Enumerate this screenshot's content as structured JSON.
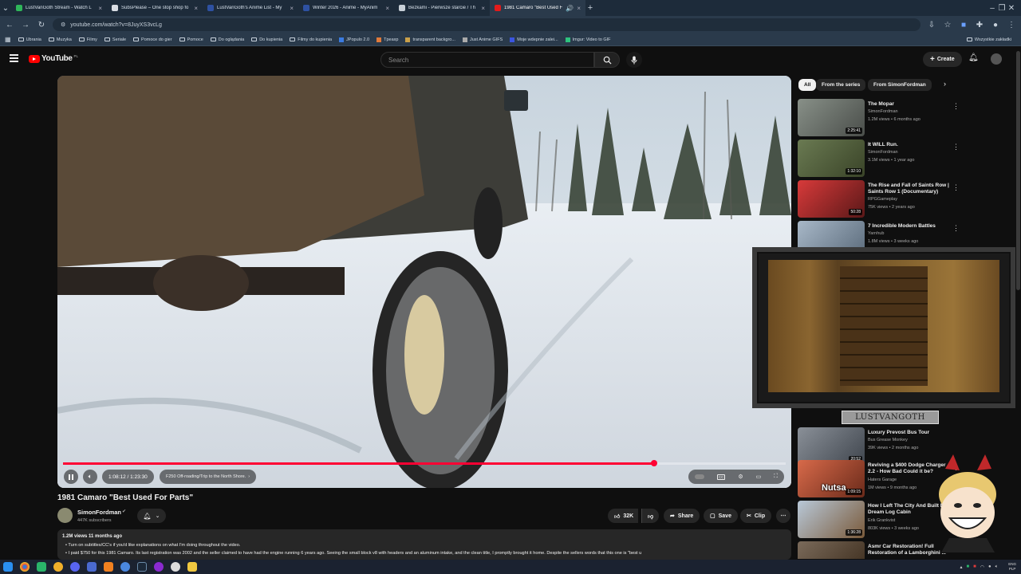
{
  "browser": {
    "tabs": [
      {
        "label": "LustVanGoth Stream - Watch L",
        "color": "#2fb65a"
      },
      {
        "label": "SubsPlease – One stop shop fo",
        "color": "#d9dde3"
      },
      {
        "label": "LustVanGoth's Anime List - My",
        "color": "#2e51a2"
      },
      {
        "label": "Winter 2026 - Anime - MyAnim",
        "color": "#2e51a2"
      },
      {
        "label": "Bezkami - Pierwsze starcie / Th",
        "color": "#c8d0d8"
      },
      {
        "label": "1981 Camaro \"Best Used F",
        "color": "#e21b1b"
      }
    ],
    "new_tab": "+",
    "url": "youtube.com/watch?v=8JuyXS3vcLg",
    "bookmarks": [
      "Ubrania",
      "Muzyka",
      "Filmy",
      "Seriale",
      "Pomoce do gier",
      "Pomoce",
      "Do oglądania",
      "Do kupienia",
      "Filmy do kupienia",
      "JPopulo 2.0",
      "Tpeaxp",
      "transparent backgro...",
      "Just Anime GIFS",
      "Moje wdepnie zalei...",
      "Imgur: Video to GIF"
    ],
    "all_bookmarks": "Wszystkie zakładki"
  },
  "youtube": {
    "logo_text": "YouTube",
    "logo_region": "PL",
    "search_placeholder": "Search",
    "create_label": "Create"
  },
  "video": {
    "title": "1981 Camaro \"Best Used For Parts\"",
    "current_time": "1:08:12",
    "total_time": "1:23:30",
    "time_display": "1:08:12 / 1:23:30",
    "chapter": "F250 Off-roading/Trip to the North Shore.",
    "progress": 0.818,
    "colors": {
      "progress": "#ff0033"
    }
  },
  "channel": {
    "name": "SimonFordman",
    "subscribers": "447K subscribers",
    "likes": "32K",
    "share_label": "Share",
    "save_label": "Save",
    "clip_label": "Clip"
  },
  "description": {
    "meta": "1.2M views  11 months ago",
    "line1": "Turn on subtitles/CC's if you'd like explanations on what I'm doing throughout the video.",
    "line2": "I paid $750 for this 1981 Camaro. Its last registration was 2002 and the seller claimed to have had the engine running 6 years ago. Seeing the small block v8 with headers and an aluminum intake, and the clean title, I promptly brought it home. Despite the sellers words that this one is \"best u"
  },
  "chips": [
    "All",
    "From the series",
    "From SimonFordman"
  ],
  "recommendations": [
    {
      "title": "The Mopar",
      "channel": "SimonFordman",
      "meta": "1.2M views • 6 months ago",
      "duration": "2:25:41",
      "thumb": "#6a6e6a"
    },
    {
      "title": "It WILL Run.",
      "channel": "SimonFordman",
      "meta": "3.1M views • 1 year ago",
      "duration": "1:32:10",
      "thumb": "#4f5a3a"
    },
    {
      "title": "The Rise and Fall of Saints Row | Saints Row 1 (Documentary)",
      "channel": "RPGGameplay",
      "meta": "75K views • 2 years ago",
      "duration": "50:28",
      "thumb": "#b02828"
    },
    {
      "title": "7 Incredible Modern Battles",
      "channel": "Yarnhub",
      "meta": "1.8M views • 3 weeks ago",
      "duration": "",
      "thumb": "#7a8a9a"
    },
    {
      "title": "Luxury Prevost Bus Tour",
      "channel": "Bus Grease Monkey",
      "meta": "39K views • 2 months ago",
      "duration": "20:52",
      "thumb": "#6a7078"
    },
    {
      "title": "Reviving a $400 Dodge Charger 2.2 - How Bad Could it be?",
      "channel": "Haters Garage",
      "meta": "1M views • 9 months ago",
      "duration": "1:09:15",
      "thumb": "#a63a2a"
    },
    {
      "title": "How I Left The City And Built My Dream Log Cabin",
      "channel": "Erik Grankvist",
      "meta": "803K views • 3 weeks ago",
      "duration": "1:36:28",
      "thumb": "#8a9aa8"
    },
    {
      "title": "Asmr Car Restoration! Full Restoration of a Lamborghini ...",
      "channel": "",
      "meta": "",
      "duration": "",
      "thumb": "#5a4a3a"
    }
  ],
  "overlay": {
    "banner": "LUSTVANGOTH",
    "mascot_caption": "Nutsa"
  },
  "taskbar": {
    "lang1": "ENG",
    "lang2": "PLP"
  }
}
